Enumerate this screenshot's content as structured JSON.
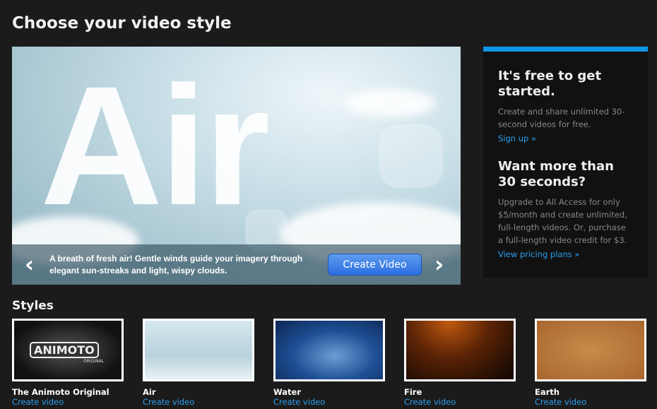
{
  "page_title": "Choose your video style",
  "hero": {
    "big_text": "Air",
    "description": "A breath of fresh air! Gentle winds guide your imagery through elegant sun-streaks and light, wispy clouds.",
    "create_button": "Create Video",
    "prev": "‹",
    "next": "›"
  },
  "sidebar": {
    "heading1": "It's free to get started.",
    "text1": "Create and share unlimited 30-second videos for free.",
    "link1": "Sign up »",
    "heading2": "Want more than 30 seconds?",
    "text2": "Upgrade to All Access for only $5/month and create unlimited, full-length videos. Or, purchase a full-length video credit for $3.",
    "link2": "View pricing plans »",
    "accent": "#0f96e8"
  },
  "styles": {
    "heading": "Styles",
    "items": [
      {
        "name": "The Animoto Original",
        "link": "Create video",
        "logo": "ANIMOTO",
        "logo_sub": "ORIGINAL"
      },
      {
        "name": "Air",
        "link": "Create video"
      },
      {
        "name": "Water",
        "link": "Create video"
      },
      {
        "name": "Fire",
        "link": "Create video"
      },
      {
        "name": "Earth",
        "link": "Create video"
      }
    ]
  }
}
